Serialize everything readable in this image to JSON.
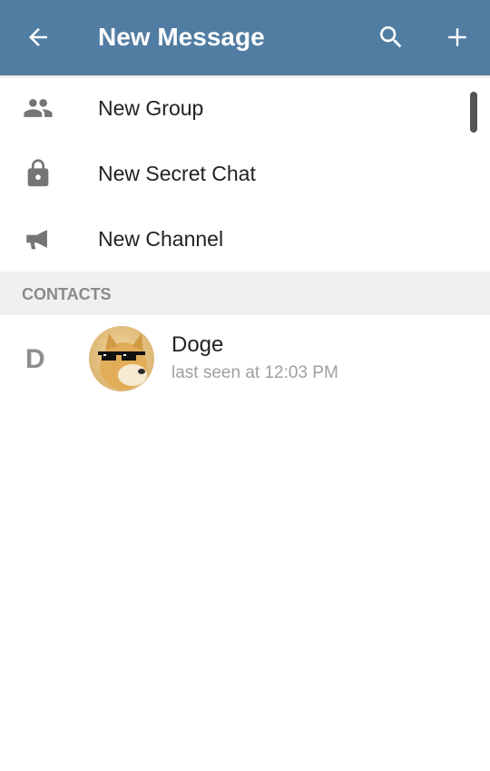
{
  "toolbar": {
    "title": "New Message",
    "back_icon": "arrow-back-icon",
    "search_icon": "search-icon",
    "add_icon": "plus-icon",
    "background_color": "#517da2",
    "text_color": "#ffffff"
  },
  "menu": {
    "items": [
      {
        "label": "New Group",
        "icon": "group-icon"
      },
      {
        "label": "New Secret Chat",
        "icon": "lock-icon"
      },
      {
        "label": "New Channel",
        "icon": "megaphone-icon"
      }
    ]
  },
  "contacts_header": {
    "label": "CONTACTS"
  },
  "contacts": [
    {
      "section_letter": "D",
      "name": "Doge",
      "status": "last seen at 12:03 PM",
      "avatar": "doge-avatar"
    }
  ]
}
